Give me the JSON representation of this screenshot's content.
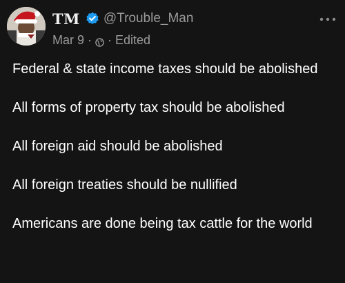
{
  "post": {
    "display_name": "TM",
    "handle": "@Trouble_Man",
    "date": "Mar 9",
    "separator": "·",
    "edited_label": "Edited",
    "paragraphs": [
      "Federal & state income taxes should be abolished",
      "All forms of property tax should be abolished",
      "All foreign aid should be abolished",
      "All foreign treaties should be nullified",
      "Americans are done being tax cattle for the world"
    ]
  },
  "icons": {
    "verified": "verified-badge-icon",
    "visibility": "globe-icon",
    "more": "more-options-icon"
  },
  "colors": {
    "background": "#141414",
    "text_primary": "#ffffff",
    "text_secondary": "#9a9a9a",
    "verified_blue": "#1d9bf0"
  }
}
